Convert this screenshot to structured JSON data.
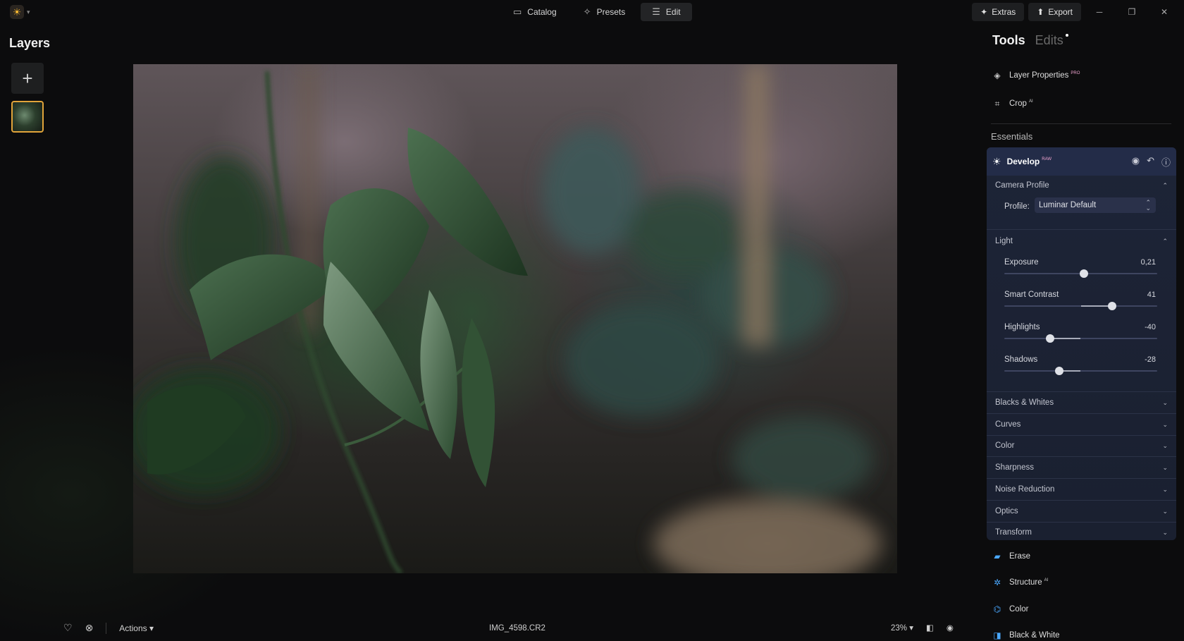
{
  "topbar": {
    "nav": [
      {
        "label": "Catalog",
        "icon": "folder-icon"
      },
      {
        "label": "Presets",
        "icon": "sparkle-icon"
      },
      {
        "label": "Edit",
        "icon": "sliders-icon",
        "active": true
      }
    ],
    "extras_label": "Extras",
    "export_label": "Export"
  },
  "layers": {
    "title": "Layers"
  },
  "tools_panel": {
    "tools_tab": "Tools",
    "edits_tab": "Edits",
    "layer_properties": "Layer Properties",
    "layer_properties_badge": "PRO",
    "crop": "Crop",
    "crop_badge": "AI",
    "essentials": "Essentials",
    "develop": {
      "title": "Develop",
      "badge": "RAW",
      "camera_profile": {
        "title": "Camera Profile",
        "profile_label": "Profile:",
        "profile_value": "Luminar Default"
      },
      "light": {
        "title": "Light",
        "sliders": [
          {
            "label": "Exposure",
            "value": "0,21",
            "position": 0.52
          },
          {
            "label": "Smart Contrast",
            "value": "41",
            "position": 0.705
          },
          {
            "label": "Highlights",
            "value": "-40",
            "position": 0.3
          },
          {
            "label": "Shadows",
            "value": "-28",
            "position": 0.36
          }
        ]
      },
      "sections": [
        "Blacks & Whites",
        "Curves",
        "Color",
        "Sharpness",
        "Noise Reduction",
        "Optics",
        "Transform"
      ]
    },
    "more_tools": [
      {
        "label": "Erase",
        "badge": ""
      },
      {
        "label": "Structure",
        "badge": "AI"
      },
      {
        "label": "Color",
        "badge": ""
      },
      {
        "label": "Black & White",
        "badge": ""
      }
    ]
  },
  "bottombar": {
    "actions_label": "Actions",
    "filename": "IMG_4598.CR2",
    "zoom": "23%"
  },
  "colors": {
    "accent": "#e1a43a",
    "develop_bg": "#1d2437",
    "tool_icon": "#4aa8ff"
  }
}
